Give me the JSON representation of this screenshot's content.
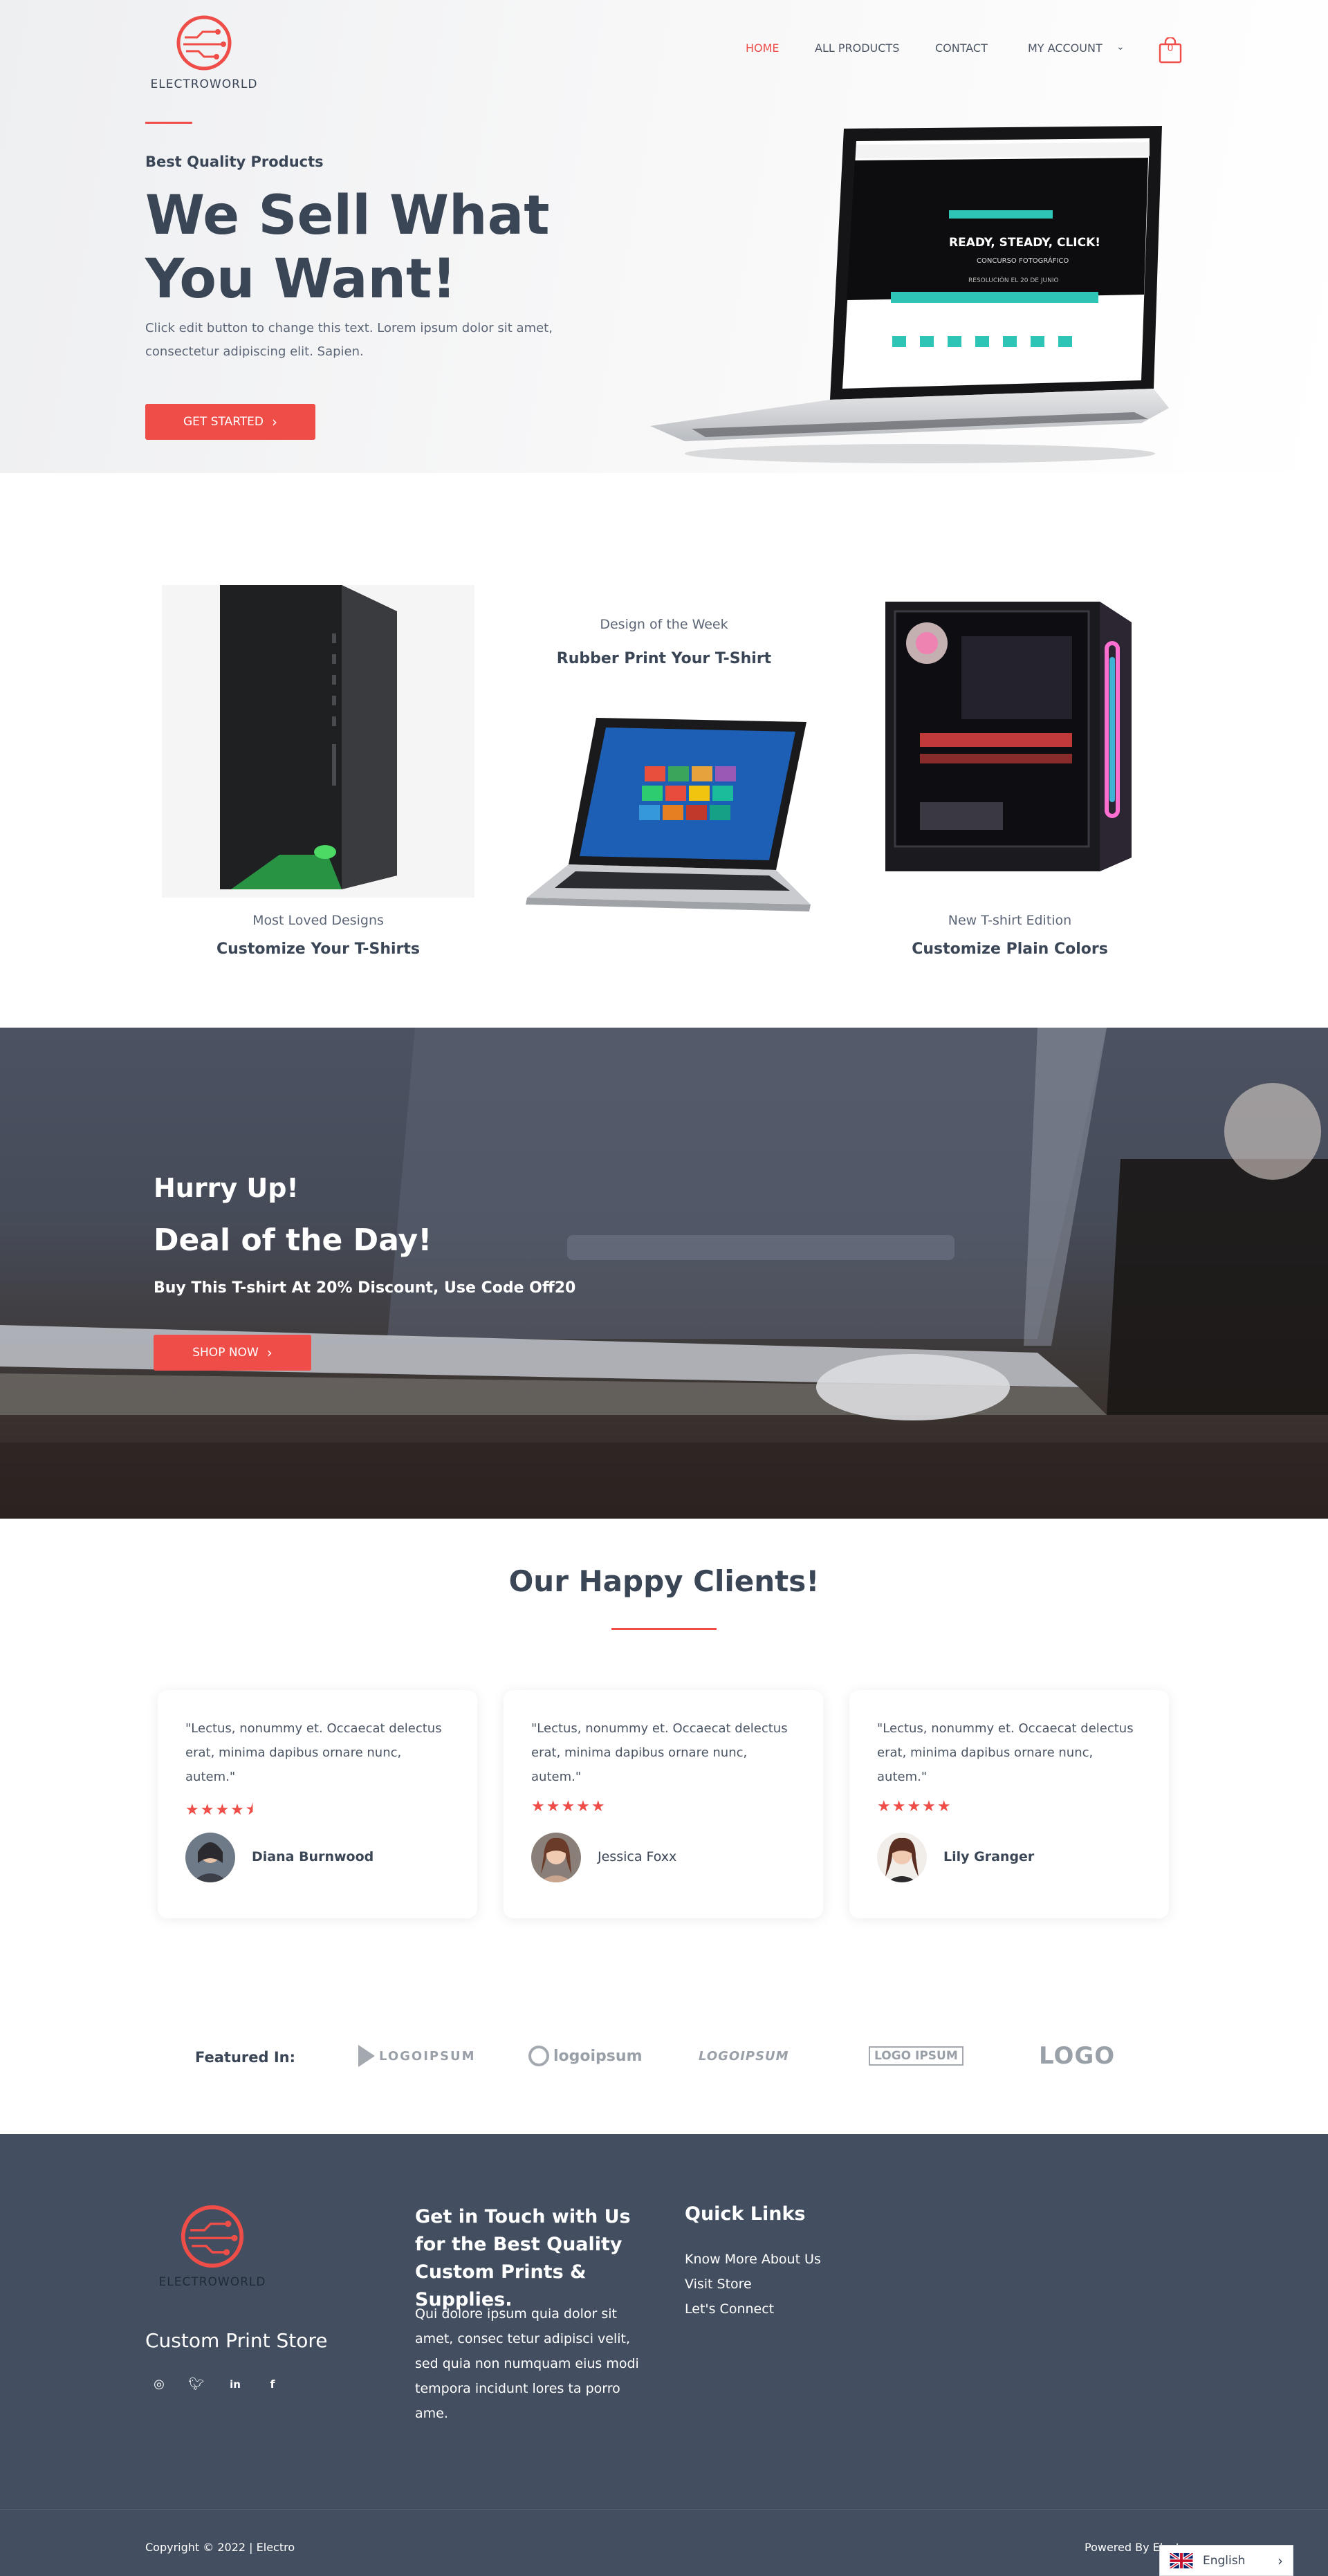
{
  "brand": {
    "name": "ELECTROWORLD",
    "accent": "#ee4d48",
    "dark": "#3a4556",
    "footer_bg": "#434f60"
  },
  "nav": {
    "items": [
      "HOME",
      "ALL PRODUCTS",
      "CONTACT",
      "MY ACCOUNT"
    ],
    "active": "HOME",
    "cart_count": "0",
    "icons": [
      "chevron-down-icon",
      "shopping-bag-icon"
    ]
  },
  "hero": {
    "tagline": "Best Quality Products",
    "title": "We Sell What You Want!",
    "text": "Click edit button to change this text. Lorem ipsum dolor sit amet, consectetur adipiscing elit. Sapien.",
    "button": "GET STARTED",
    "screen": {
      "headline": "READY, STEADY, CLICK!",
      "sub": "CONCURSO FOTOGRÁFICO",
      "date": "RESOLUCIÓN EL 20 DE JUNIO"
    }
  },
  "products": [
    {
      "caption": "Most Loved Designs",
      "title": "Customize Your T-Shirts"
    },
    {
      "caption": "Design of the Week",
      "title": "Rubber Print Your T-Shirt"
    },
    {
      "caption": "New T-shirt Edition",
      "title": "Customize Plain Colors"
    }
  ],
  "deal": {
    "line1": "Hurry Up!",
    "line2": "Deal of the Day!",
    "text": "Buy This T-shirt At 20% Discount, Use Code Off20",
    "button": "SHOP NOW"
  },
  "clients": {
    "title": "Our Happy Clients!",
    "items": [
      {
        "quote": "\"Lectus, nonummy et. Occaecat delectus erat, minima dapibus ornare nunc, autem.\"",
        "rating": 4.5,
        "stars": "★★★★⯨",
        "name": "Diana Burnwood"
      },
      {
        "quote": "\"Lectus, nonummy et. Occaecat delectus erat, minima dapibus ornare nunc, autem.\"",
        "rating": 5,
        "stars": "★★★★★",
        "name": "Jessica Foxx"
      },
      {
        "quote": "\"Lectus, nonummy et. Occaecat delectus erat, minima dapibus ornare nunc, autem.\"",
        "rating": 5,
        "stars": "★★★★★",
        "name": "Lily Granger"
      }
    ]
  },
  "featured": {
    "label": "Featured In:",
    "logos": [
      "LOGOIPSUM",
      "logoipsum",
      "LOGOIPSUM",
      "LOGO IPSUM",
      "LOGO"
    ]
  },
  "footer": {
    "store": "Custom Print Store",
    "social_icons": [
      "instagram-icon",
      "twitter-icon",
      "linkedin-icon",
      "facebook-icon"
    ],
    "contact_title": "Get in Touch with Us for the Best Quality Custom Prints & Supplies.",
    "about": "Qui dolore ipsum quia dolor sit amet, consec tetur adipisci velit, sed quia non numquam eius modi tempora incidunt lores ta porro ame.",
    "quick_links_title": "Quick Links",
    "quick_links": [
      "Know More About Us",
      "Visit Store",
      "Let's Connect"
    ],
    "copyright": "Copyright © 2022 | Electro",
    "powered": "Powered By Electro"
  },
  "language": {
    "label": "English",
    "icons": [
      "uk-flag-icon",
      "chevron-right-icon"
    ]
  }
}
